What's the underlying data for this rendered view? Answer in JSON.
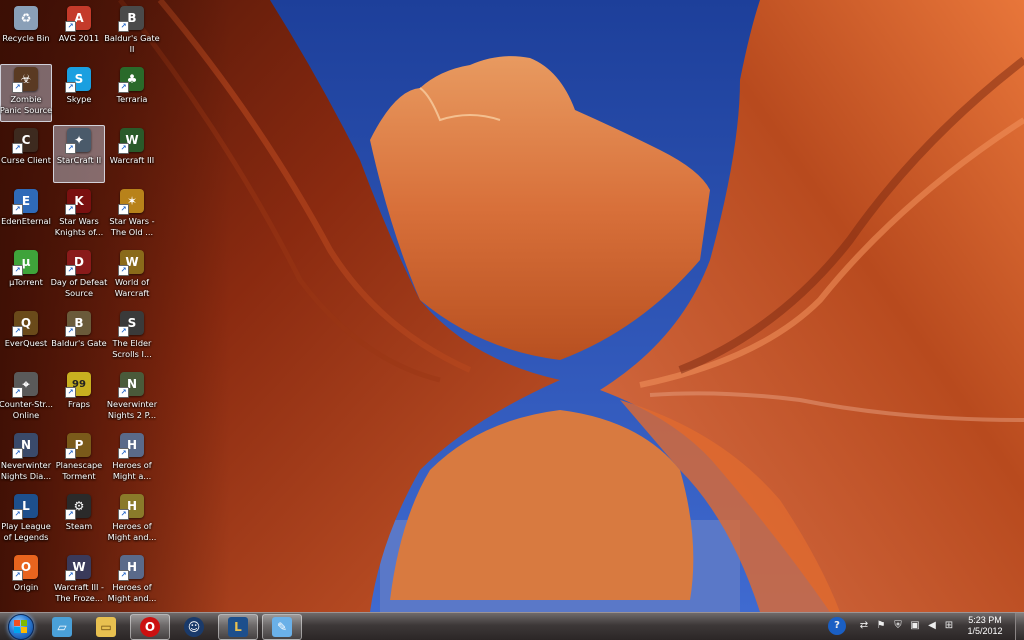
{
  "desktop": {
    "icons": [
      {
        "label": "Recycle Bin",
        "icon": "recycle-bin-icon",
        "color": "#8aa0b8",
        "glyph": "♻",
        "shortcut": false
      },
      {
        "label": "Zombie\nPanic Source",
        "icon": "zombie-panic-icon",
        "color": "#5a3a22",
        "glyph": "☣",
        "shortcut": true
      },
      {
        "label": "Curse Client",
        "icon": "curse-client-icon",
        "color": "#3d2a1f",
        "glyph": "C",
        "shortcut": true
      },
      {
        "label": "EdenEternal",
        "icon": "eden-eternal-icon",
        "color": "#2f6ab8",
        "glyph": "E",
        "shortcut": true
      },
      {
        "label": "µTorrent",
        "icon": "utorrent-icon",
        "color": "#3fa33a",
        "glyph": "µ",
        "shortcut": true
      },
      {
        "label": "EverQuest",
        "icon": "everquest-icon",
        "color": "#6a4a1a",
        "glyph": "Q",
        "shortcut": true
      },
      {
        "label": "Counter-Str...\nOnline",
        "icon": "counter-strike-icon",
        "color": "#5a5a5a",
        "glyph": "⌖",
        "shortcut": true
      },
      {
        "label": "Neverwinter\nNights Dia...",
        "icon": "neverwinter-icon",
        "color": "#3a4a6a",
        "glyph": "N",
        "shortcut": true
      },
      {
        "label": "Play League\nof Legends",
        "icon": "league-of-legends-icon",
        "color": "#1d4f8c",
        "glyph": "L",
        "shortcut": true
      },
      {
        "label": "Origin",
        "icon": "origin-icon",
        "color": "#e8641e",
        "glyph": "O",
        "shortcut": true
      },
      {
        "label": "AVG 2011",
        "icon": "avg-icon",
        "color": "#c43a2a",
        "glyph": "A",
        "shortcut": true
      },
      {
        "label": "Skype",
        "icon": "skype-icon",
        "color": "#1a9fe0",
        "glyph": "S",
        "shortcut": true
      },
      {
        "label": "StarCraft II",
        "icon": "starcraft-icon",
        "color": "#4a5a6a",
        "glyph": "✦",
        "shortcut": true
      },
      {
        "label": "Star Wars\nKnights of...",
        "icon": "star-wars-kotor-icon",
        "color": "#7a1010",
        "glyph": "K",
        "shortcut": true
      },
      {
        "label": "Day of Defeat\nSource",
        "icon": "day-of-defeat-icon",
        "color": "#8a1a1a",
        "glyph": "D",
        "shortcut": true
      },
      {
        "label": "Baldur's Gate",
        "icon": "baldurs-gate-icon",
        "color": "#6a5a3a",
        "glyph": "B",
        "shortcut": true
      },
      {
        "label": "Fraps",
        "icon": "fraps-icon",
        "color": "#c8b020",
        "glyph": "99",
        "shortcut": true
      },
      {
        "label": "Planescape\nTorment",
        "icon": "planescape-icon",
        "color": "#7a5a1a",
        "glyph": "P",
        "shortcut": true
      },
      {
        "label": "Steam",
        "icon": "steam-icon",
        "color": "#2a2a2a",
        "glyph": "⚙",
        "shortcut": true
      },
      {
        "label": "Warcraft III -\nThe Froze...",
        "icon": "warcraft-frozen-throne-icon",
        "color": "#3a3a5a",
        "glyph": "W",
        "shortcut": true
      },
      {
        "label": "Baldur's Gate\nII",
        "icon": "baldurs-gate-2-icon",
        "color": "#4a4a4a",
        "glyph": "B",
        "shortcut": true
      },
      {
        "label": "Terraria",
        "icon": "terraria-icon",
        "color": "#2a6a2a",
        "glyph": "♣",
        "shortcut": true
      },
      {
        "label": "Warcraft III",
        "icon": "warcraft-3-icon",
        "color": "#2a5a2a",
        "glyph": "W",
        "shortcut": true
      },
      {
        "label": "Star Wars -\nThe Old ...",
        "icon": "star-wars-tor-icon",
        "color": "#b8821a",
        "glyph": "✶",
        "shortcut": true
      },
      {
        "label": "World of\nWarcraft",
        "icon": "world-of-warcraft-icon",
        "color": "#8a6a1a",
        "glyph": "W",
        "shortcut": true
      },
      {
        "label": "The Elder\nScrolls I...",
        "icon": "elder-scrolls-icon",
        "color": "#3a3a3a",
        "glyph": "S",
        "shortcut": true
      },
      {
        "label": "Neverwinter\nNights 2 P...",
        "icon": "neverwinter-2-icon",
        "color": "#4a5a3a",
        "glyph": "N",
        "shortcut": true
      },
      {
        "label": "Heroes of\nMight a...",
        "icon": "heroes-might-magic-icon",
        "color": "#5a6a8a",
        "glyph": "H",
        "shortcut": true
      },
      {
        "label": "Heroes of\nMight and...",
        "icon": "heroes-might-magic-2-icon",
        "color": "#8a7a2a",
        "glyph": "H",
        "shortcut": true
      },
      {
        "label": "Heroes of\nMight and...",
        "icon": "heroes-might-magic-3-icon",
        "color": "#5a6a8a",
        "glyph": "H",
        "shortcut": true
      }
    ],
    "selected": [
      "Zombie\nPanic Source",
      "StarCraft II"
    ]
  },
  "taskbar": {
    "start_icon": "windows-start-orb-icon",
    "pinned": [
      {
        "name": "windows-explorer-icon",
        "color": "#4aa0d8",
        "glyph": "▱",
        "active": false
      },
      {
        "name": "folder-icon",
        "color": "#e8c050",
        "glyph": "▭",
        "active": false
      },
      {
        "name": "opera-icon",
        "color": "#cc1010",
        "glyph": "O",
        "active": true
      },
      {
        "name": "steam-chat-icon",
        "color": "#1a3a6a",
        "glyph": "☺",
        "active": false
      },
      {
        "name": "league-of-legends-icon",
        "color": "#1d4f8c",
        "glyph": "L",
        "active": true
      },
      {
        "name": "paint-icon",
        "color": "#6ab0e8",
        "glyph": "✎",
        "active": true
      }
    ],
    "tray": {
      "icons": [
        "help-icon",
        "network-app-icon",
        "flag-icon",
        "shield-icon",
        "network-icon",
        "volume-icon",
        "windows-flag-icon"
      ],
      "time": "5:23 PM",
      "date": "1/5/2012"
    }
  }
}
